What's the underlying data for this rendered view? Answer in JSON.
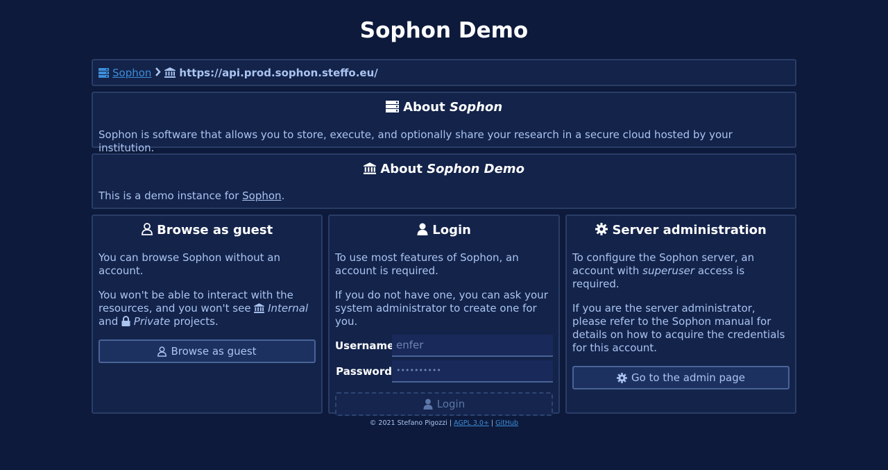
{
  "page": {
    "title": "Sophon Demo"
  },
  "breadcrumb": {
    "root_label": "Sophon",
    "separator_icon": "chevron-right-icon",
    "instance_url": "https://api.prod.sophon.steffo.eu/"
  },
  "about_sophon": {
    "heading_prefix": "About ",
    "heading_name": "Sophon",
    "text": "Sophon is software that allows you to store, execute, and optionally share your research in a secure cloud hosted by your institution."
  },
  "about_demo": {
    "heading_prefix": "About ",
    "heading_name": "Sophon Demo",
    "text_before": "This is a demo instance for ",
    "link": "Sophon",
    "text_after": "."
  },
  "guest": {
    "heading": "Browse as guest",
    "p1": "You can browse Sophon without an account.",
    "p2_a": "You won't be able to interact with the resources, and you won't see ",
    "p2_internal": "Internal",
    "p2_and": "and ",
    "p2_private": "Private",
    "p2_end": " projects.",
    "button": "Browse as guest"
  },
  "login": {
    "heading": "Login",
    "p1": "To use most features of Sophon, an account is required.",
    "p2": "If you do not have one, you can ask your system administrator to create one for you.",
    "username_label": "Username",
    "username_value": "enfer",
    "password_label": "Password",
    "password_value": "••••••••••",
    "button": "Login"
  },
  "admin": {
    "heading": "Server administration",
    "p1_a": "To configure the Sophon server, an account with ",
    "p1_em": "superuser",
    "p1_b": " access is required.",
    "p2": "If you are the server administrator, please refer to the Sophon manual for details on how to acquire the credentials for this account.",
    "button": "Go to the admin page"
  },
  "footer": {
    "copyright": "© 2021 Stefano Pigozzi",
    "sep1": " | ",
    "license": "AGPL 3.0+",
    "sep2": " | ",
    "github": "GitHub"
  },
  "colors": {
    "background": "#0d1a3c",
    "panel": "#13234a",
    "link": "#3d8ed9",
    "text": "#aac4f0"
  }
}
